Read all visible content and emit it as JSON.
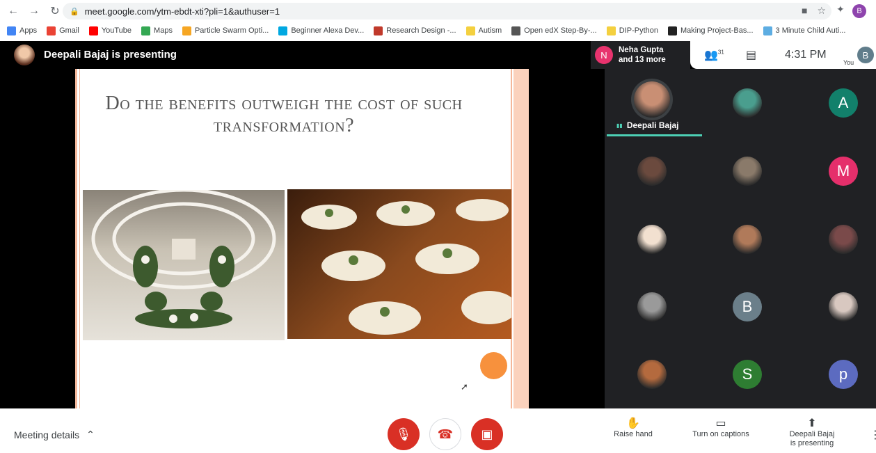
{
  "browser": {
    "url": "meet.google.com/ytm-ebdt-xti?pli=1&authuser=1",
    "profile_initial": "B",
    "bookmarks": [
      {
        "label": "Apps",
        "color": "#4285f4"
      },
      {
        "label": "Gmail",
        "color": "#ea4335"
      },
      {
        "label": "YouTube",
        "color": "#ff0000"
      },
      {
        "label": "Maps",
        "color": "#34a853"
      },
      {
        "label": "Particle Swarm Opti...",
        "color": "#f6a623"
      },
      {
        "label": "Beginner Alexa Dev...",
        "color": "#00a8e1"
      },
      {
        "label": "Research Design -...",
        "color": "#c0392b"
      },
      {
        "label": "Autism",
        "color": "#f4d03f"
      },
      {
        "label": "Open edX Step-By-...",
        "color": "#555555"
      },
      {
        "label": "DIP-Python",
        "color": "#f4d03f"
      },
      {
        "label": "Making Project-Bas...",
        "color": "#222222"
      },
      {
        "label": "3 Minute Child Auti...",
        "color": "#5dade2"
      }
    ]
  },
  "meet": {
    "presenting_title": "Deepali Bajaj is presenting",
    "notification": {
      "initial": "N",
      "line1": "Neha Gupta",
      "line2": "and 13 more"
    },
    "people_count": "31",
    "time": "4:31 PM",
    "you_label": "You",
    "you_initial": "B"
  },
  "slide": {
    "title": "Do the benefits outweigh the cost of such transformation?"
  },
  "participants": [
    {
      "type": "photo",
      "label": "Deepali Bajaj",
      "speaking": true,
      "color": "#c98f74"
    },
    {
      "type": "photo",
      "label": "",
      "color": "#4a9e8e"
    },
    {
      "type": "initial",
      "initial": "A",
      "color": "#12806b"
    },
    {
      "type": "photo",
      "label": "",
      "color": "#6b4a3e"
    },
    {
      "type": "photo",
      "label": "",
      "color": "#8a7a6a"
    },
    {
      "type": "initial",
      "initial": "M",
      "color": "#e52f6b"
    },
    {
      "type": "photo",
      "label": "",
      "color": "#f2e0d0"
    },
    {
      "type": "photo",
      "label": "",
      "color": "#b07a5a"
    },
    {
      "type": "photo",
      "label": "",
      "color": "#7a4a4a"
    },
    {
      "type": "photo",
      "label": "",
      "color": "#9a9a9a"
    },
    {
      "type": "initial",
      "initial": "B",
      "color": "#6b7f8a"
    },
    {
      "type": "photo",
      "label": "",
      "color": "#d8c8c0"
    },
    {
      "type": "photo",
      "label": "",
      "color": "#b46a3e"
    },
    {
      "type": "initial",
      "initial": "S",
      "color": "#2e7d32"
    },
    {
      "type": "initial",
      "initial": "p",
      "color": "#5c6bc0"
    }
  ],
  "bottom": {
    "meeting_details": "Meeting details",
    "raise_hand": "Raise hand",
    "captions": "Turn on captions",
    "presenting_line1": "Deepali Bajaj",
    "presenting_line2": "is presenting"
  },
  "colors": {
    "end_call": "#d93025",
    "mic_off": "#d93025",
    "cam_off": "#d93025",
    "speaking": "#4dd0b5"
  }
}
